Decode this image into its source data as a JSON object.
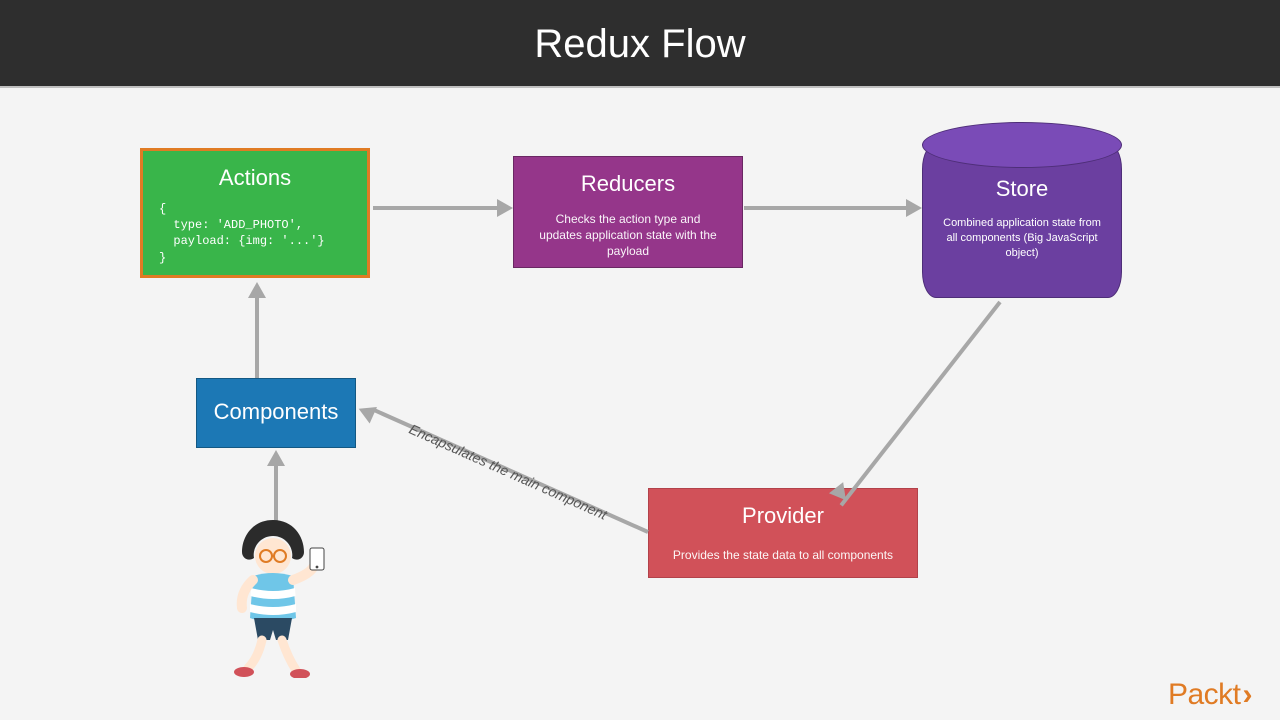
{
  "title": "Redux Flow",
  "nodes": {
    "actions": {
      "title": "Actions",
      "code": "{\n  type: 'ADD_PHOTO',\n  payload: {img: '...'}\n}"
    },
    "reducers": {
      "title": "Reducers",
      "desc": "Checks the action type and updates application state with the payload"
    },
    "store": {
      "title": "Store",
      "desc": "Combined application state from all components\n(Big JavaScript object)"
    },
    "provider": {
      "title": "Provider",
      "desc": "Provides the state data to all components"
    },
    "components": {
      "title": "Components"
    }
  },
  "edge_label": "Encapsulates the main component",
  "brand": "Packt",
  "flow": [
    "Actions → Reducers",
    "Reducers → Store",
    "Store → Provider",
    "Provider → Components",
    "Components → Actions",
    "User → Components"
  ]
}
